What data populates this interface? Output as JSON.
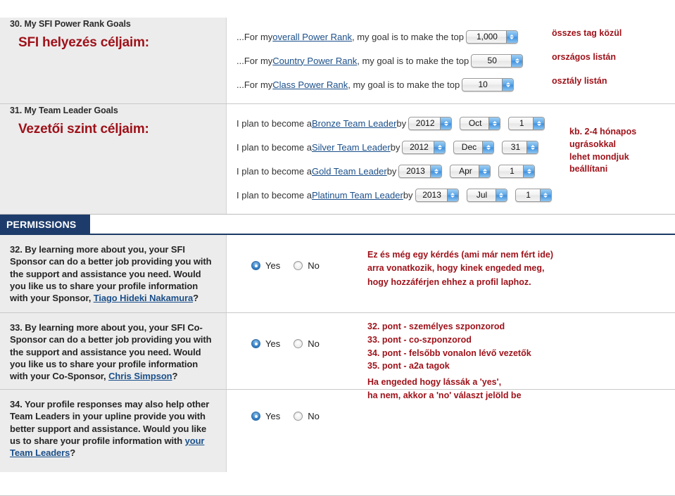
{
  "sections": {
    "power_rank": {
      "number_label": "30. My SFI Power Rank Goals",
      "hu_heading": "SFI helyezés céljaim:",
      "lines": [
        {
          "prefix": "...For my ",
          "link": "overall Power Rank",
          "suffix": ", my goal is to make the top",
          "value": "1,000",
          "annotation": "összes tag közül"
        },
        {
          "prefix": "...For my ",
          "link": "Country Power Rank",
          "suffix": ", my goal is to make the top",
          "value": "50",
          "annotation": "országos listán"
        },
        {
          "prefix": "...For my ",
          "link": "Class Power Rank",
          "suffix": ", my goal is to make the top",
          "value": "10",
          "annotation": "osztály listán"
        }
      ]
    },
    "team_leader": {
      "number_label": "31. My Team Leader Goals",
      "hu_heading": "Vezetői szint céljaim:",
      "annotation": "kb. 2-4 hónapos\nugrásokkal\nlehet mondjuk\nbeállítani",
      "lines": [
        {
          "prefix": "I plan to become a ",
          "link": "Bronze Team Leader",
          "suffix": " by",
          "year": "2012",
          "month": "Oct",
          "day": "1"
        },
        {
          "prefix": "I plan to become a ",
          "link": "Silver Team Leader",
          "suffix": " by",
          "year": "2012",
          "month": "Dec",
          "day": "31"
        },
        {
          "prefix": "I plan to become a ",
          "link": "Gold Team Leader",
          "suffix": " by",
          "year": "2013",
          "month": "Apr",
          "day": "1"
        },
        {
          "prefix": "I plan to become a ",
          "link": "Platinum Team Leader",
          "suffix": " by",
          "year": "2013",
          "month": "Jul",
          "day": "1"
        }
      ]
    },
    "permissions": {
      "tab_label": "PERMISSIONS",
      "questions": [
        {
          "text_before": "32. By learning more about you, your SFI Sponsor can do a better job providing you with the support and assistance you need. Would you like us to share your profile information with your Sponsor, ",
          "link": "Tiago Hideki Nakamura",
          "text_after": "?",
          "yes_label": "Yes",
          "no_label": "No",
          "selected": "Yes"
        },
        {
          "text_before": "33. By learning more about you, your SFI Co-Sponsor can do a better job providing you with the support and assistance you need. Would you like us to share your profile information with your Co-Sponsor, ",
          "link": "Chris Simpson",
          "text_after": "?",
          "yes_label": "Yes",
          "no_label": "No",
          "selected": "Yes"
        },
        {
          "text_before": "34. Your profile responses may also help other Team Leaders in your upline provide you with better support and assistance. Would you like us to share your profile information with ",
          "link": "your Team Leaders",
          "text_after": "?",
          "yes_label": "Yes",
          "no_label": "No",
          "selected": "Yes"
        }
      ],
      "annotation_top": "Ez és még egy kérdés (ami már nem fért ide)\narra vonatkozik, hogy kinek engeded meg,\nhogy hozzáférjen ehhez a profil laphoz.",
      "annotation_list": "32. pont - személyes szponzorod\n33. pont - co-szponzorod\n34. pont - felsőbb vonalon lévő vezetők\n35. pont - a2a tagok",
      "annotation_bottom": "Ha engeded hogy lássák a 'yes',\nha nem, akkor a 'no' választ jelöld be"
    }
  },
  "colors": {
    "annotation_red": "#9e1119",
    "link_blue": "#1b4f8a",
    "tab_navy": "#1d3c6b"
  }
}
